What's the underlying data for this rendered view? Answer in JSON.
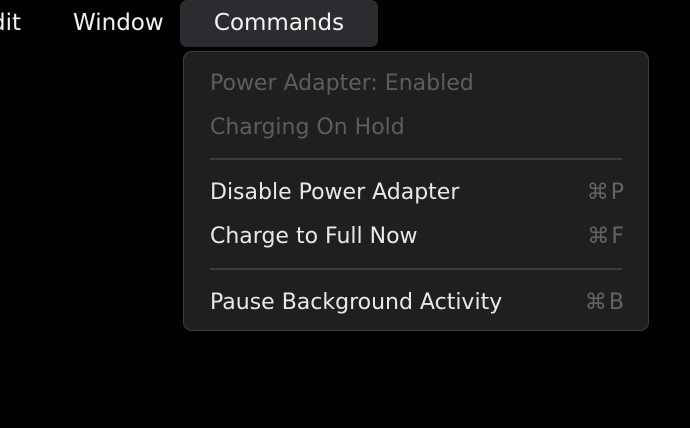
{
  "menubar": {
    "items": [
      {
        "label": "dit"
      },
      {
        "label": "Window"
      },
      {
        "label": "Commands"
      }
    ]
  },
  "dropdown": {
    "items": [
      {
        "label": "Power Adapter: Enabled",
        "shortcut": "",
        "enabled": false
      },
      {
        "label": "Charging On Hold",
        "shortcut": "",
        "enabled": false
      },
      {
        "label": "Disable Power Adapter",
        "shortcut": "⌘P",
        "enabled": true
      },
      {
        "label": "Charge to Full Now",
        "shortcut": "⌘F",
        "enabled": true
      },
      {
        "label": "Pause Background Activity",
        "shortcut": "⌘B",
        "enabled": true
      }
    ]
  },
  "colors": {
    "background": "#000000",
    "menu_bg": "#1f1f1f",
    "menu_border": "#3e3e40",
    "highlight": "#2c2c2e",
    "text_enabled": "#e8e8e8",
    "text_disabled": "#5d5d5f"
  }
}
